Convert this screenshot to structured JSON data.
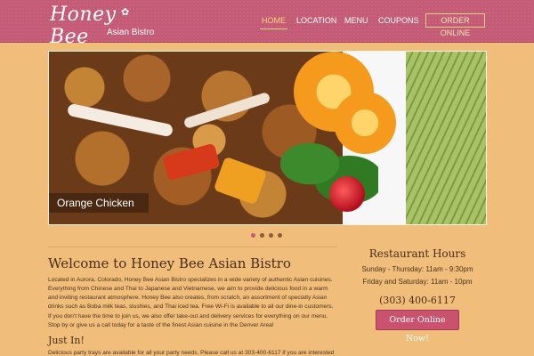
{
  "logo": {
    "script": "Honey Bee",
    "subtitle": "Asian Bistro"
  },
  "nav": {
    "items": [
      {
        "label": "HOME"
      },
      {
        "label": "LOCATION"
      },
      {
        "label": "MENU"
      },
      {
        "label": "COUPONS"
      },
      {
        "label": "ORDER ONLINE"
      }
    ],
    "active_index": 0
  },
  "slider": {
    "caption": "Orange Chicken",
    "dot_count": 4,
    "active_dot": 0
  },
  "welcome": {
    "title": "Welcome to Honey Bee Asian Bistro",
    "para1": "Located in Aurora, Colorado, Honey Bee Asian Bistro specializes in a wide variety of authentic Asian cuisines. Everything from Chinese and Thai to Japanese and Vietnamese, we aim to provide delicious food in a warm and inviting restaurant atmosphere. Honey Bee also creates, from scratch, an assortment of specialty Asian drinks such as Boba milk teas, slushies, and Thai iced tea. Free Wi-Fi is available to all our dine-in customers.",
    "para2": "If you don't have the time to join us, we also offer take-out and delivery services for everything on our menu. Stop by or give us a call today for a taste of the finest Asian cuisine in the Denver Area!",
    "just_in": "Just In!",
    "party": "Delicious party trays are available for all your party needs. Please call us at 303-400-6117 if you are interested"
  },
  "hours": {
    "title": "Restaurant Hours",
    "line1": "Sunday - Thursday: 11am - 9:30pm",
    "line2": "Friday and Saturday: 11am - 10pm",
    "phone": "(303) 400-6117",
    "order_button": "Order Online Now!"
  },
  "colors": {
    "header": "#c45a76",
    "page_bg": "#f1bd7a",
    "accent_gold": "#ffd27c",
    "button": "#c9536f"
  }
}
